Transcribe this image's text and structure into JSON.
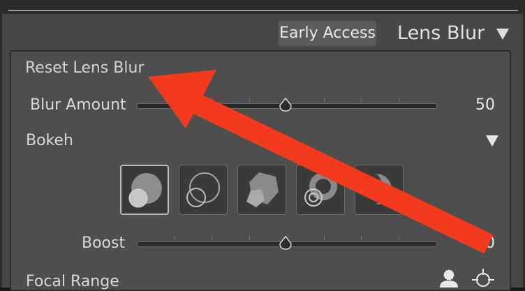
{
  "header": {
    "early_access_label": "Early Access",
    "section_title": "Lens Blur"
  },
  "lens_blur": {
    "reset_label": "Reset Lens Blur",
    "blur_amount": {
      "label": "Blur Amount",
      "value": "50",
      "level": 0.5
    },
    "bokeh": {
      "label": "Bokeh",
      "shapes": [
        {
          "name": "circle",
          "selected": true
        },
        {
          "name": "bubble",
          "selected": false
        },
        {
          "name": "5-blade",
          "selected": false
        },
        {
          "name": "ring",
          "selected": false
        },
        {
          "name": "cat-eye",
          "selected": false
        }
      ]
    },
    "boost": {
      "label": "Boost",
      "value": "50",
      "level": 0.5
    },
    "focal_range": {
      "label": "Focal Range"
    }
  },
  "annotation": {
    "arrow_color": "#f23a1c"
  },
  "icons": [
    "collapse-triangle-icon",
    "bokeh-expand-icon",
    "person-select-icon",
    "target-picker-icon"
  ]
}
